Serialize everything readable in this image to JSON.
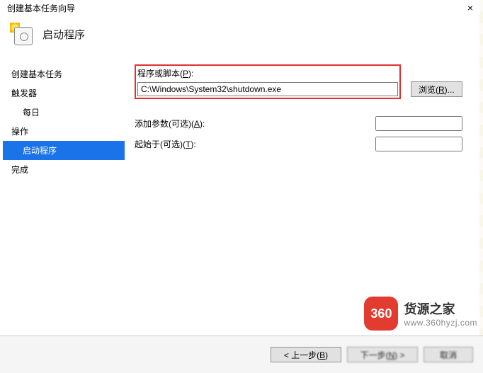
{
  "window": {
    "title": "创建基本任务向导"
  },
  "header": {
    "title": "启动程序"
  },
  "sidebar": {
    "s1": "创建基本任务",
    "s2": "触发器",
    "s2a": "每日",
    "s3": "操作",
    "s3a": "启动程序",
    "s4": "完成"
  },
  "form": {
    "program_label_pre": "程序或脚本(",
    "program_label_u": "P",
    "program_label_post": "):",
    "program_value": "C:\\Windows\\System32\\shutdown.exe",
    "browse_pre": "浏览(",
    "browse_u": "R",
    "browse_post": ")...",
    "args_label_pre": "添加参数(可选)(",
    "args_label_u": "A",
    "args_label_post": "):",
    "args_value": "",
    "start_label_pre": "起始于(可选)(",
    "start_label_u": "T",
    "start_label_post": "):",
    "start_value": ""
  },
  "footer": {
    "back_pre": "< 上一步(",
    "back_u": "B",
    "back_post": ")",
    "next_pre": "下一步(",
    "next_u": "N",
    "next_post": ") >",
    "cancel": "取消"
  },
  "watermark": {
    "badge": "360",
    "line1": "货源之家",
    "line2": "www.360hyzj.com"
  }
}
